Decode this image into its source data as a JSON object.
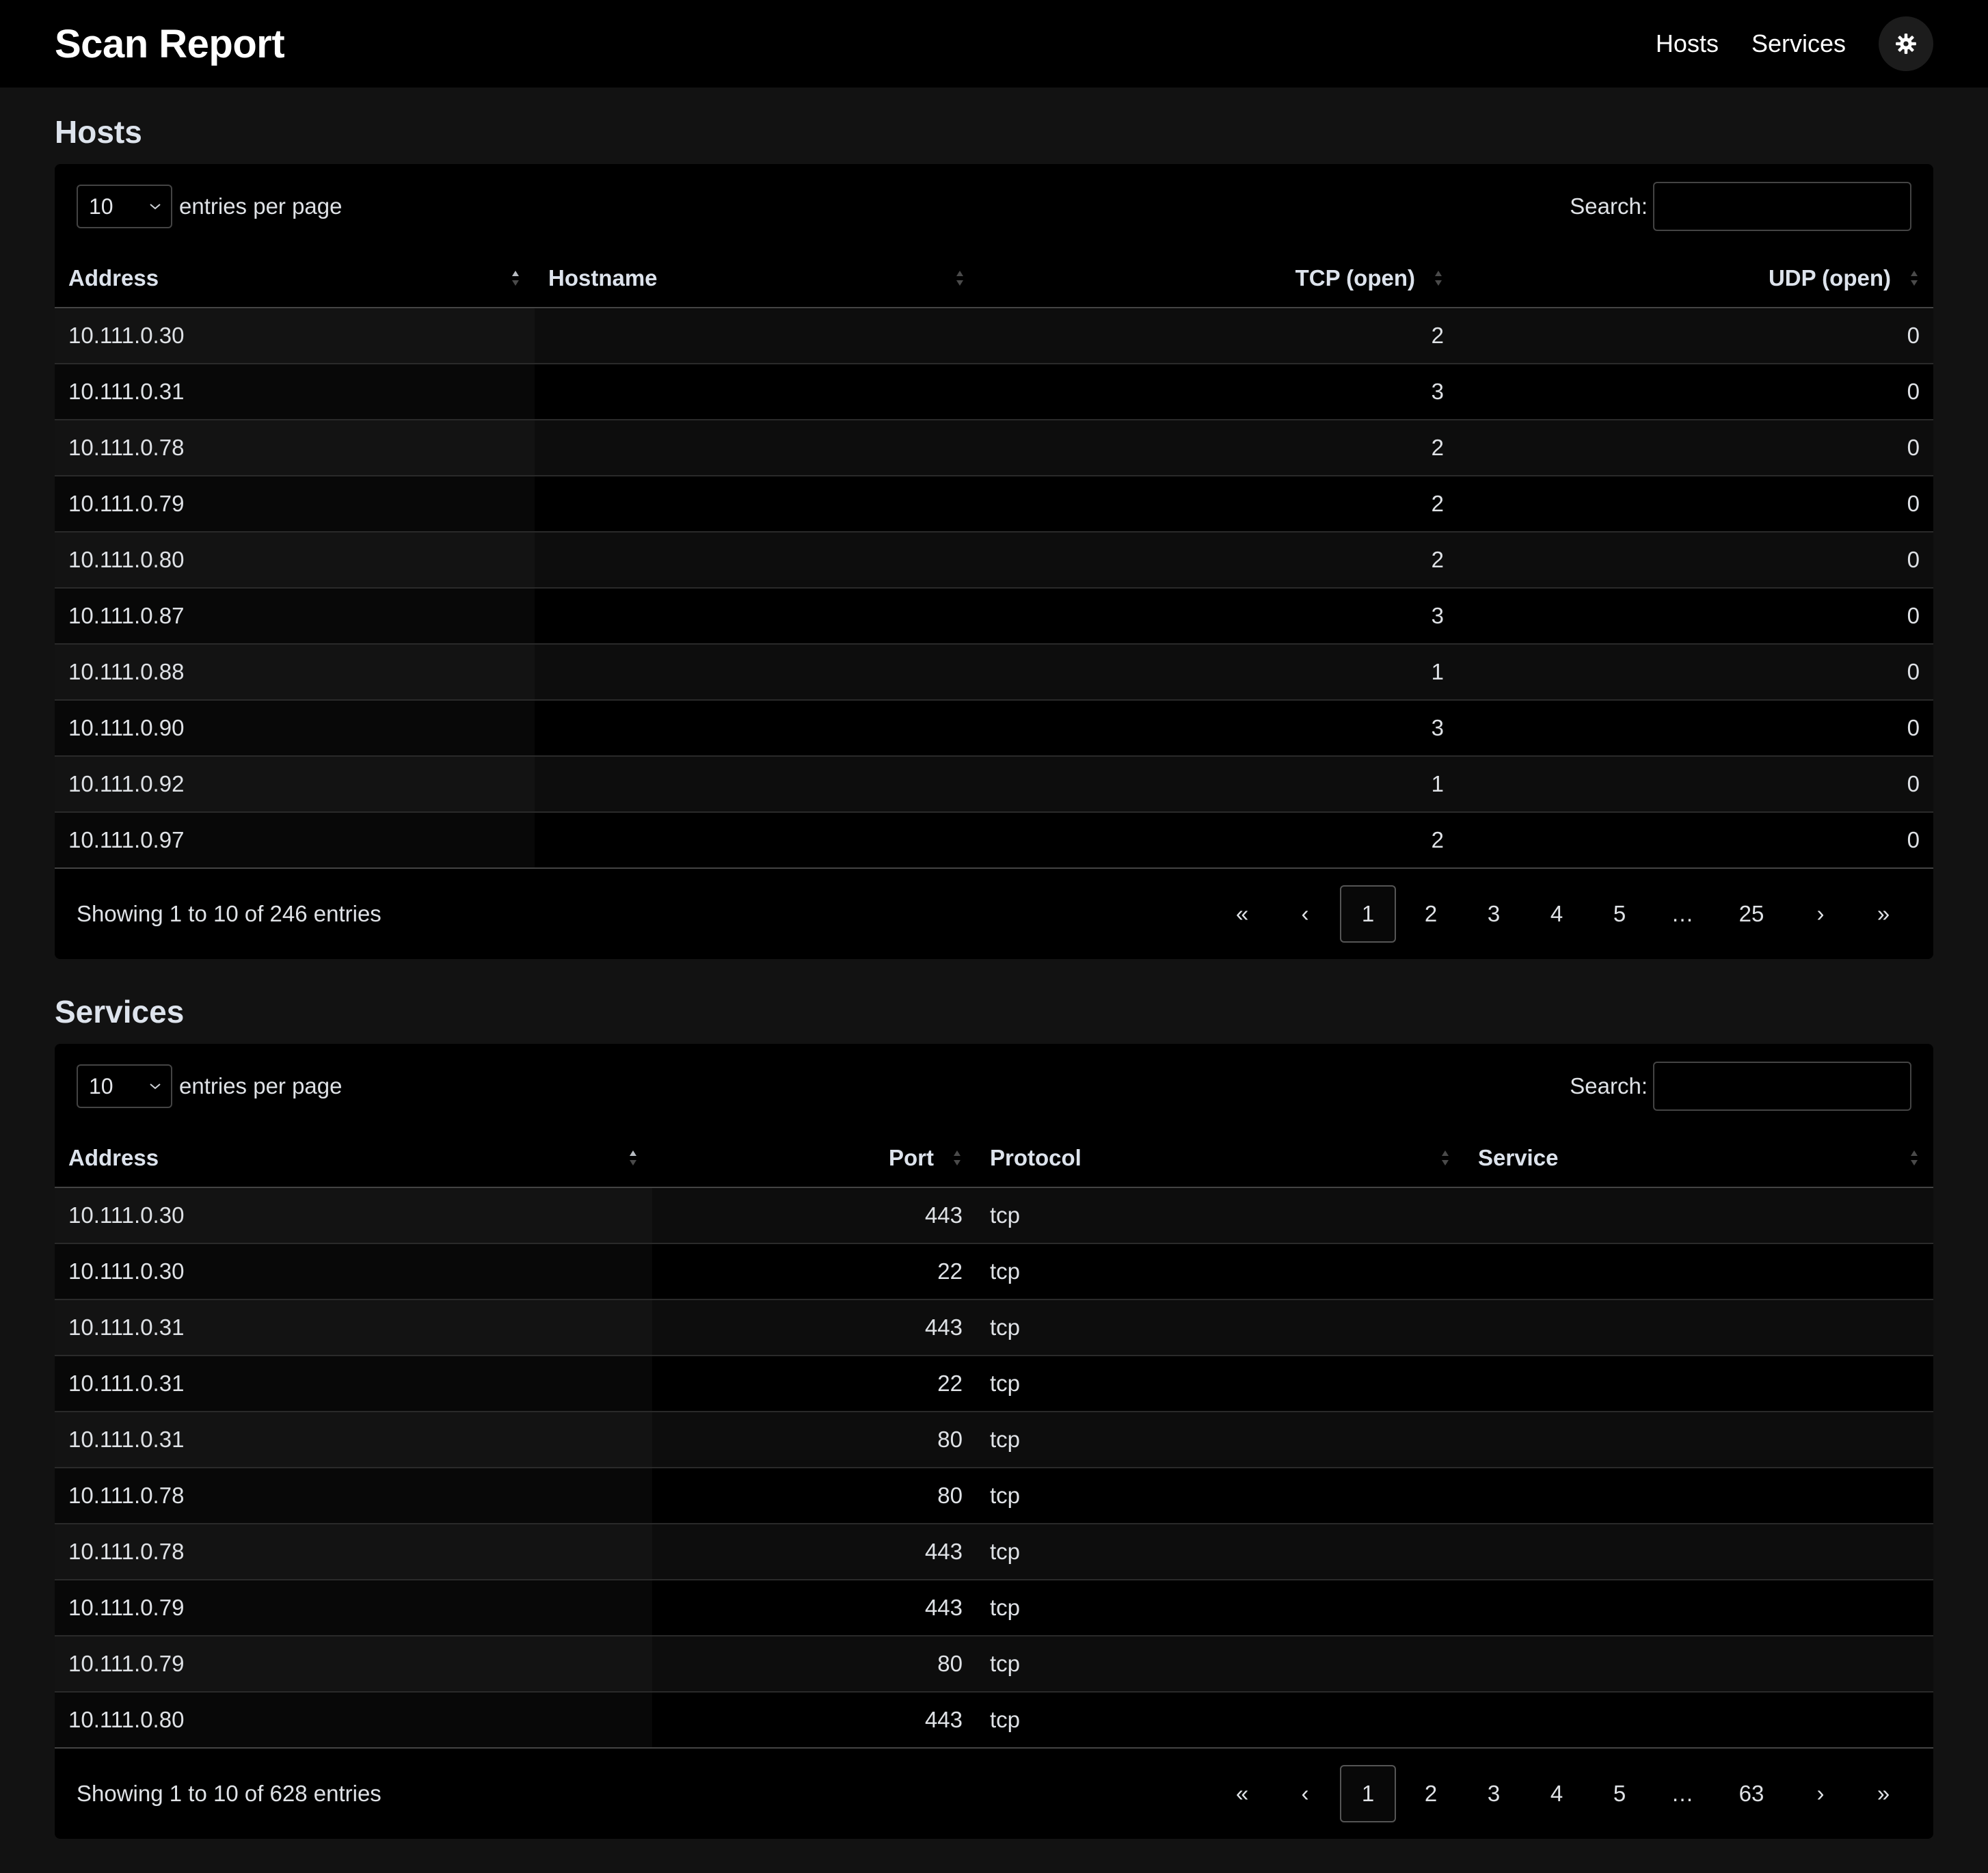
{
  "navbar": {
    "brand": "Scan Report",
    "links": [
      "Hosts",
      "Services"
    ],
    "theme_icon": "gear-icon"
  },
  "hosts": {
    "title": "Hosts",
    "length_value": "10",
    "length_label": "entries per page",
    "search_label": "Search:",
    "search_value": "",
    "columns": [
      "Address",
      "Hostname",
      "TCP (open)",
      "UDP (open)"
    ],
    "sorted_column": "Address",
    "rows": [
      [
        "10.111.0.30",
        "",
        "2",
        "0"
      ],
      [
        "10.111.0.31",
        "",
        "3",
        "0"
      ],
      [
        "10.111.0.78",
        "",
        "2",
        "0"
      ],
      [
        "10.111.0.79",
        "",
        "2",
        "0"
      ],
      [
        "10.111.0.80",
        "",
        "2",
        "0"
      ],
      [
        "10.111.0.87",
        "",
        "3",
        "0"
      ],
      [
        "10.111.0.88",
        "",
        "1",
        "0"
      ],
      [
        "10.111.0.90",
        "",
        "3",
        "0"
      ],
      [
        "10.111.0.92",
        "",
        "1",
        "0"
      ],
      [
        "10.111.0.97",
        "",
        "2",
        "0"
      ]
    ],
    "info": "Showing 1 to 10 of 246 entries",
    "pages": [
      "«",
      "‹",
      "1",
      "2",
      "3",
      "4",
      "5",
      "…",
      "25",
      "›",
      "»"
    ],
    "current_page": "1"
  },
  "services": {
    "title": "Services",
    "length_value": "10",
    "length_label": "entries per page",
    "search_label": "Search:",
    "search_value": "",
    "columns": [
      "Address",
      "Port",
      "Protocol",
      "Service"
    ],
    "sorted_column": "Address",
    "rows": [
      [
        "10.111.0.30",
        "443",
        "tcp",
        ""
      ],
      [
        "10.111.0.30",
        "22",
        "tcp",
        ""
      ],
      [
        "10.111.0.31",
        "443",
        "tcp",
        ""
      ],
      [
        "10.111.0.31",
        "22",
        "tcp",
        ""
      ],
      [
        "10.111.0.31",
        "80",
        "tcp",
        ""
      ],
      [
        "10.111.0.78",
        "80",
        "tcp",
        ""
      ],
      [
        "10.111.0.78",
        "443",
        "tcp",
        ""
      ],
      [
        "10.111.0.79",
        "443",
        "tcp",
        ""
      ],
      [
        "10.111.0.79",
        "80",
        "tcp",
        ""
      ],
      [
        "10.111.0.80",
        "443",
        "tcp",
        ""
      ]
    ],
    "info": "Showing 1 to 10 of 628 entries",
    "pages": [
      "«",
      "‹",
      "1",
      "2",
      "3",
      "4",
      "5",
      "…",
      "63",
      "›",
      "»"
    ],
    "current_page": "1"
  }
}
